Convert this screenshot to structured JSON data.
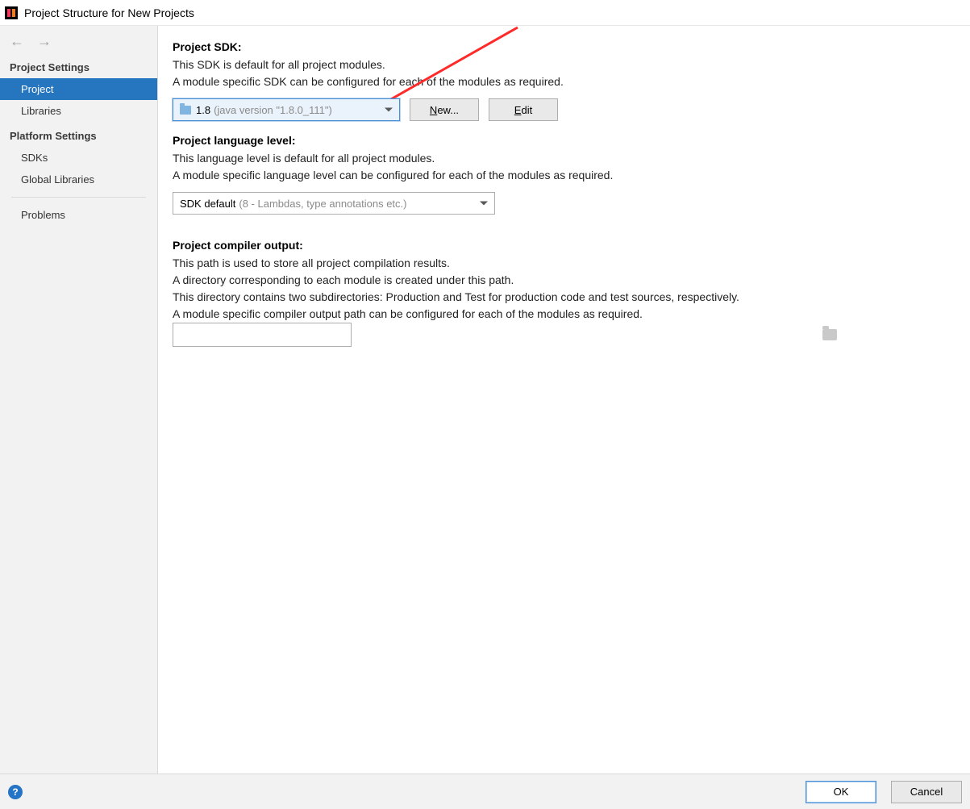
{
  "window": {
    "title": "Project Structure for New Projects"
  },
  "sidebar": {
    "sections": {
      "project_settings_header": "Project Settings",
      "platform_settings_header": "Platform Settings"
    },
    "items": {
      "project": "Project",
      "libraries": "Libraries",
      "sdks": "SDKs",
      "global_libraries": "Global Libraries",
      "problems": "Problems"
    }
  },
  "main": {
    "sdk": {
      "title": "Project SDK:",
      "desc1": "This SDK is default for all project modules.",
      "desc2": "A module specific SDK can be configured for each of the modules as required.",
      "combo_primary": "1.8",
      "combo_secondary": "(java version \"1.8.0_111\")",
      "new_btn": "New...",
      "edit_btn": "Edit"
    },
    "lang": {
      "title": "Project language level:",
      "desc1": "This language level is default for all project modules.",
      "desc2": "A module specific language level can be configured for each of the modules as required.",
      "combo_primary": "SDK default",
      "combo_secondary": "(8 - Lambdas, type annotations etc.)"
    },
    "output": {
      "title": "Project compiler output:",
      "desc1": "This path is used to store all project compilation results.",
      "desc2": "A directory corresponding to each module is created under this path.",
      "desc3": "This directory contains two subdirectories: Production and Test for production code and test sources, respectively.",
      "desc4": "A module specific compiler output path can be configured for each of the modules as required.",
      "value": ""
    }
  },
  "footer": {
    "ok": "OK",
    "cancel": "Cancel",
    "help_glyph": "?"
  },
  "colors": {
    "selection": "#2675bf",
    "accent": "#4a90d9",
    "panel": "#f2f2f2"
  }
}
